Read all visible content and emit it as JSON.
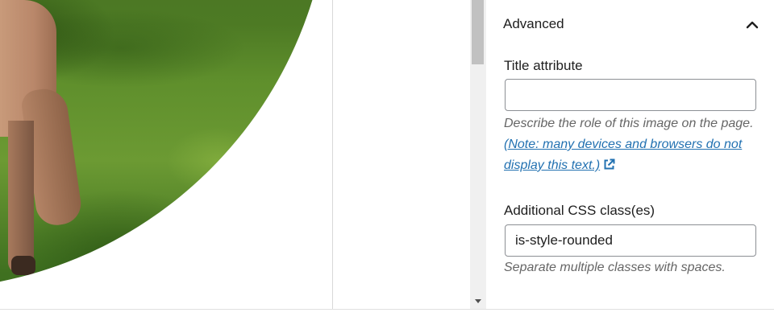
{
  "panel": {
    "section_title": "Advanced",
    "title_attribute": {
      "label": "Title attribute",
      "value": "",
      "help_text": "Describe the role of this image on the page.",
      "help_link": "(Note: many devices and browsers do not display this text.)"
    },
    "css_class": {
      "label": "Additional CSS class(es)",
      "value": "is-style-rounded",
      "help_text": "Separate multiple classes with spaces."
    }
  },
  "colors": {
    "link": "#2271b1",
    "help_text": "#666666",
    "input_border": "#8c8f94"
  },
  "icons": [
    "chevron-up-icon",
    "external-link-icon",
    "scroll-down-arrow-icon"
  ]
}
